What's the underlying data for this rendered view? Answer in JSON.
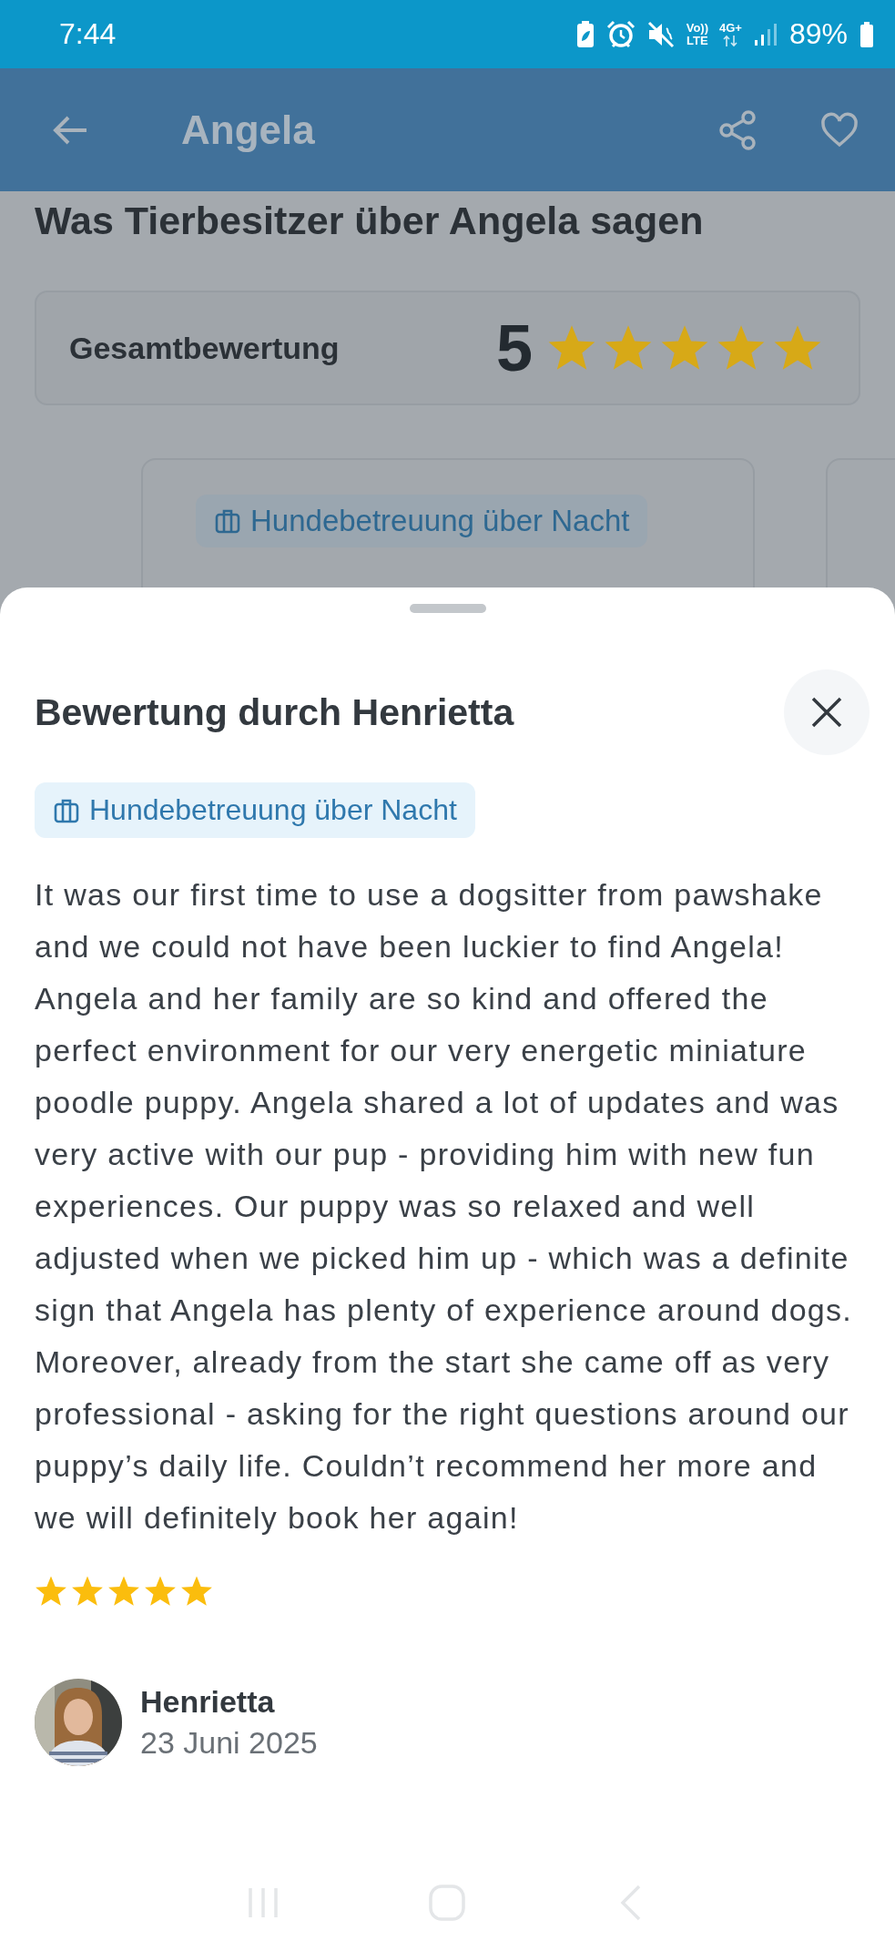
{
  "status_bar": {
    "time": "7:44",
    "volte_top": "Vo))",
    "volte_bottom": "LTE",
    "network": "4G+",
    "battery": "89%"
  },
  "header": {
    "title": "Angela"
  },
  "page": {
    "heading": "Was Tierbesitzer über Angela sagen",
    "overall": {
      "label": "Gesamtbewertung",
      "score": "5",
      "stars": 5
    },
    "review_cards": [
      {
        "tag": "Hundebetreuung über Nacht"
      }
    ]
  },
  "sheet": {
    "title": "Bewertung durch Henrietta",
    "tag": "Hundebetreuung über Nacht",
    "text": "It was our first time to use a dogsitter from pawshake and we could not have been luckier to find Angela! Angela and her family are so kind and offered the perfect environment for our very energetic miniature poodle puppy. Angela shared a lot of updates and was very active with our pup - providing him with new fun experiences. Our puppy was so relaxed and well adjusted when we picked him up - which was a definite sign that Angela has plenty of experience around dogs. Moreover, already from the start she came off as very professional - asking for the right questions around our puppy’s daily life. Couldn’t recommend her more and we will definitely book her again!",
    "stars": 5,
    "reviewer": {
      "name": "Henrietta",
      "date": "23 Juni 2025"
    }
  }
}
